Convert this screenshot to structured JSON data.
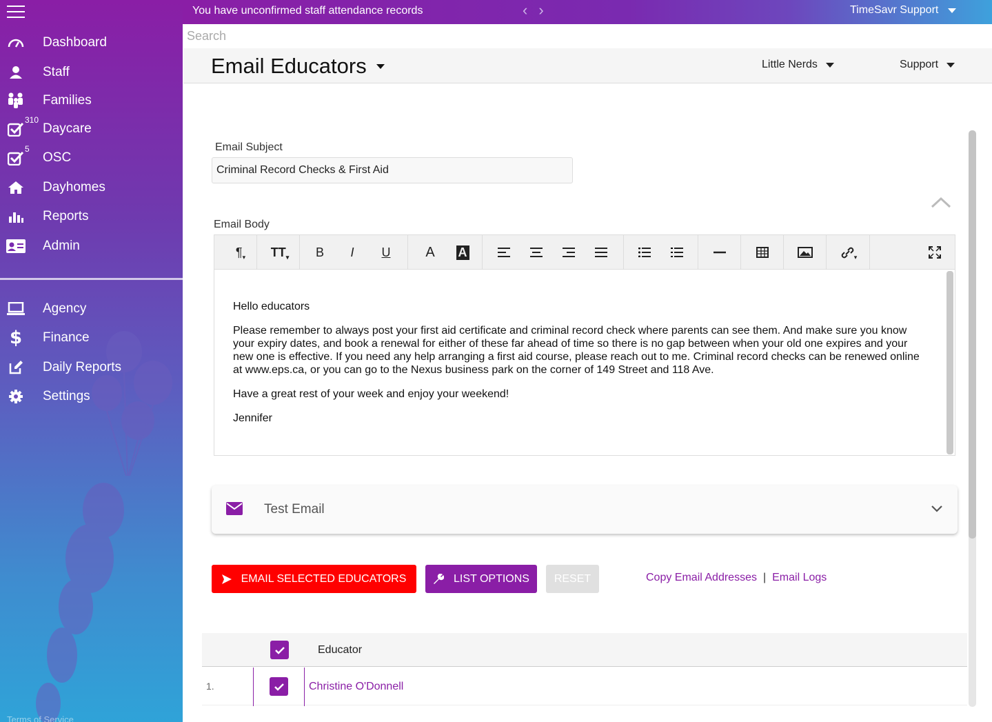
{
  "topbar": {
    "notice": "You have unconfirmed staff attendance records",
    "user": "TimeSavr Support"
  },
  "search": {
    "placeholder": "Search"
  },
  "sidebar": {
    "items": [
      {
        "label": "Dashboard",
        "icon": "speedometer-icon"
      },
      {
        "label": "Staff",
        "icon": "person-icon"
      },
      {
        "label": "Families",
        "icon": "family-icon"
      },
      {
        "label": "Daycare",
        "icon": "checkbox-icon",
        "badge": "310"
      },
      {
        "label": "OSC",
        "icon": "checkbox-icon",
        "badge": "5"
      },
      {
        "label": "Dayhomes",
        "icon": "home-icon"
      },
      {
        "label": "Reports",
        "icon": "bar-chart-icon"
      },
      {
        "label": "Admin",
        "icon": "id-card-icon"
      }
    ],
    "items2": [
      {
        "label": "Agency",
        "icon": "laptop-icon"
      },
      {
        "label": "Finance",
        "icon": "dollar-icon"
      },
      {
        "label": "Daily Reports",
        "icon": "edit-icon"
      },
      {
        "label": "Settings",
        "icon": "gear-icon"
      }
    ],
    "footer": "Terms of Service"
  },
  "header": {
    "title": "Email Educators",
    "center": "Little Nerds",
    "support": "Support"
  },
  "form": {
    "subject_label": "Email Subject",
    "subject_value": "Criminal Record Checks & First Aid",
    "body_label": "Email Body"
  },
  "editor": {
    "toolbar_labels": {
      "bold": "B",
      "italic": "I",
      "underline": "U",
      "font_color": "A",
      "bg_color": "A"
    },
    "paragraphs": [
      "Hello educators",
      "Please remember to always post your first aid certificate and criminal record check where parents can see them.   And make sure you know your expiry dates, and book a renewal for either of these far ahead of time so there is no gap between when your old one expires and your new one is effective.  If you need any help arranging a first aid course, please reach out to me.  Criminal record checks can be renewed online at www.eps.ca, or you can go to the Nexus business park on the corner of 149 Street and 118 Ave.",
      "Have a great rest of your week and enjoy your weekend!",
      "Jennifer"
    ]
  },
  "test_email": {
    "label": "Test Email"
  },
  "actions": {
    "email_selected": "EMAIL SELECTED EDUCATORS",
    "list_options": "LIST OPTIONS",
    "reset": "RESET",
    "copy_emails": "Copy Email Addresses",
    "separator": "|",
    "email_logs": "Email Logs"
  },
  "table": {
    "header": "Educator",
    "rows": [
      {
        "num": "1.",
        "name": "Christine O'Donnell"
      }
    ]
  },
  "colors": {
    "accent": "#8a1ea6",
    "danger": "#ff0000",
    "disabled": "#e0e0e0"
  }
}
